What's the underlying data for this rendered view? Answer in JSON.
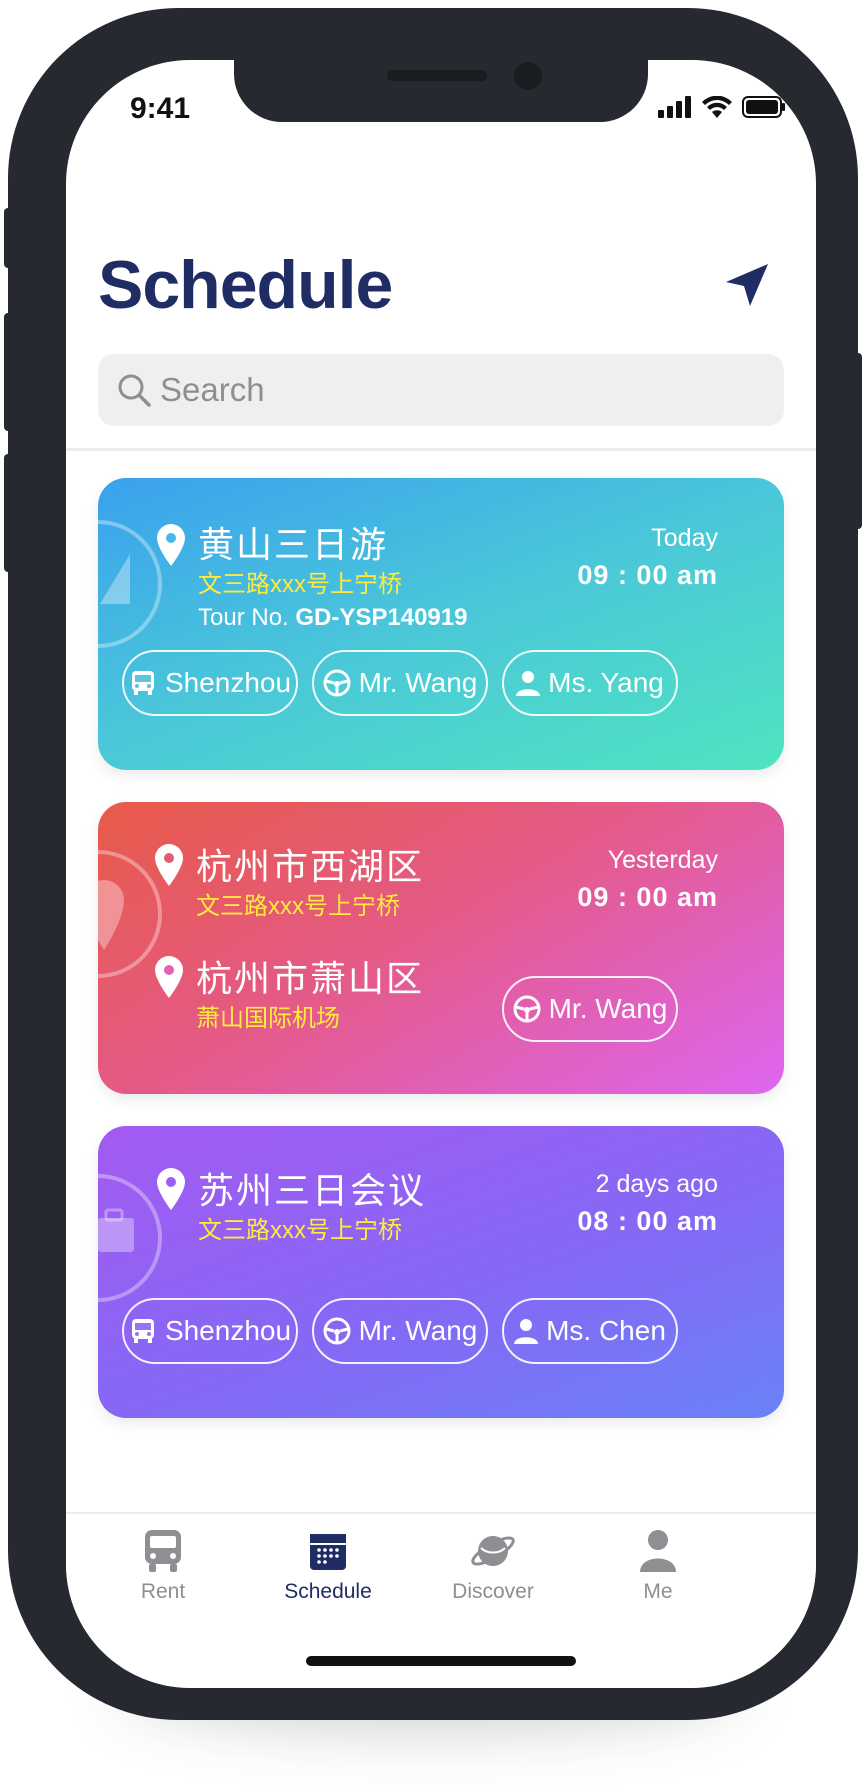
{
  "status": {
    "time": "9:41"
  },
  "header": {
    "title": "Schedule"
  },
  "search": {
    "placeholder": "Search"
  },
  "cards": [
    {
      "place": "黄山三日游",
      "address": "文三路xxx号上宁桥",
      "tour_label": "Tour No.",
      "tour_no": "GD-YSP140919",
      "when": "Today",
      "time": "09 : 00 am",
      "chips": [
        "Shenzhou",
        "Mr. Wang",
        "Ms. Yang"
      ]
    },
    {
      "place": "杭州市西湖区",
      "address": "文三路xxx号上宁桥",
      "dest_place": "杭州市萧山区",
      "dest_address": "萧山国际机场",
      "when": "Yesterday",
      "time": "09 : 00 am",
      "chips": [
        "Mr. Wang"
      ]
    },
    {
      "place": "苏州三日会议",
      "address": "文三路xxx号上宁桥",
      "when": "2 days ago",
      "time": "08 : 00 am",
      "chips": [
        "Shenzhou",
        "Mr. Wang",
        "Ms. Chen"
      ]
    }
  ],
  "tabbar": {
    "items": [
      {
        "label": "Rent",
        "icon": "bus-icon"
      },
      {
        "label": "Schedule",
        "icon": "calendar-icon",
        "active": true
      },
      {
        "label": "Discover",
        "icon": "planet-icon"
      },
      {
        "label": "Me",
        "icon": "person-icon"
      }
    ]
  },
  "colors": {
    "accent": "#1f2d64",
    "address_yellow": "#ffeb3b"
  }
}
